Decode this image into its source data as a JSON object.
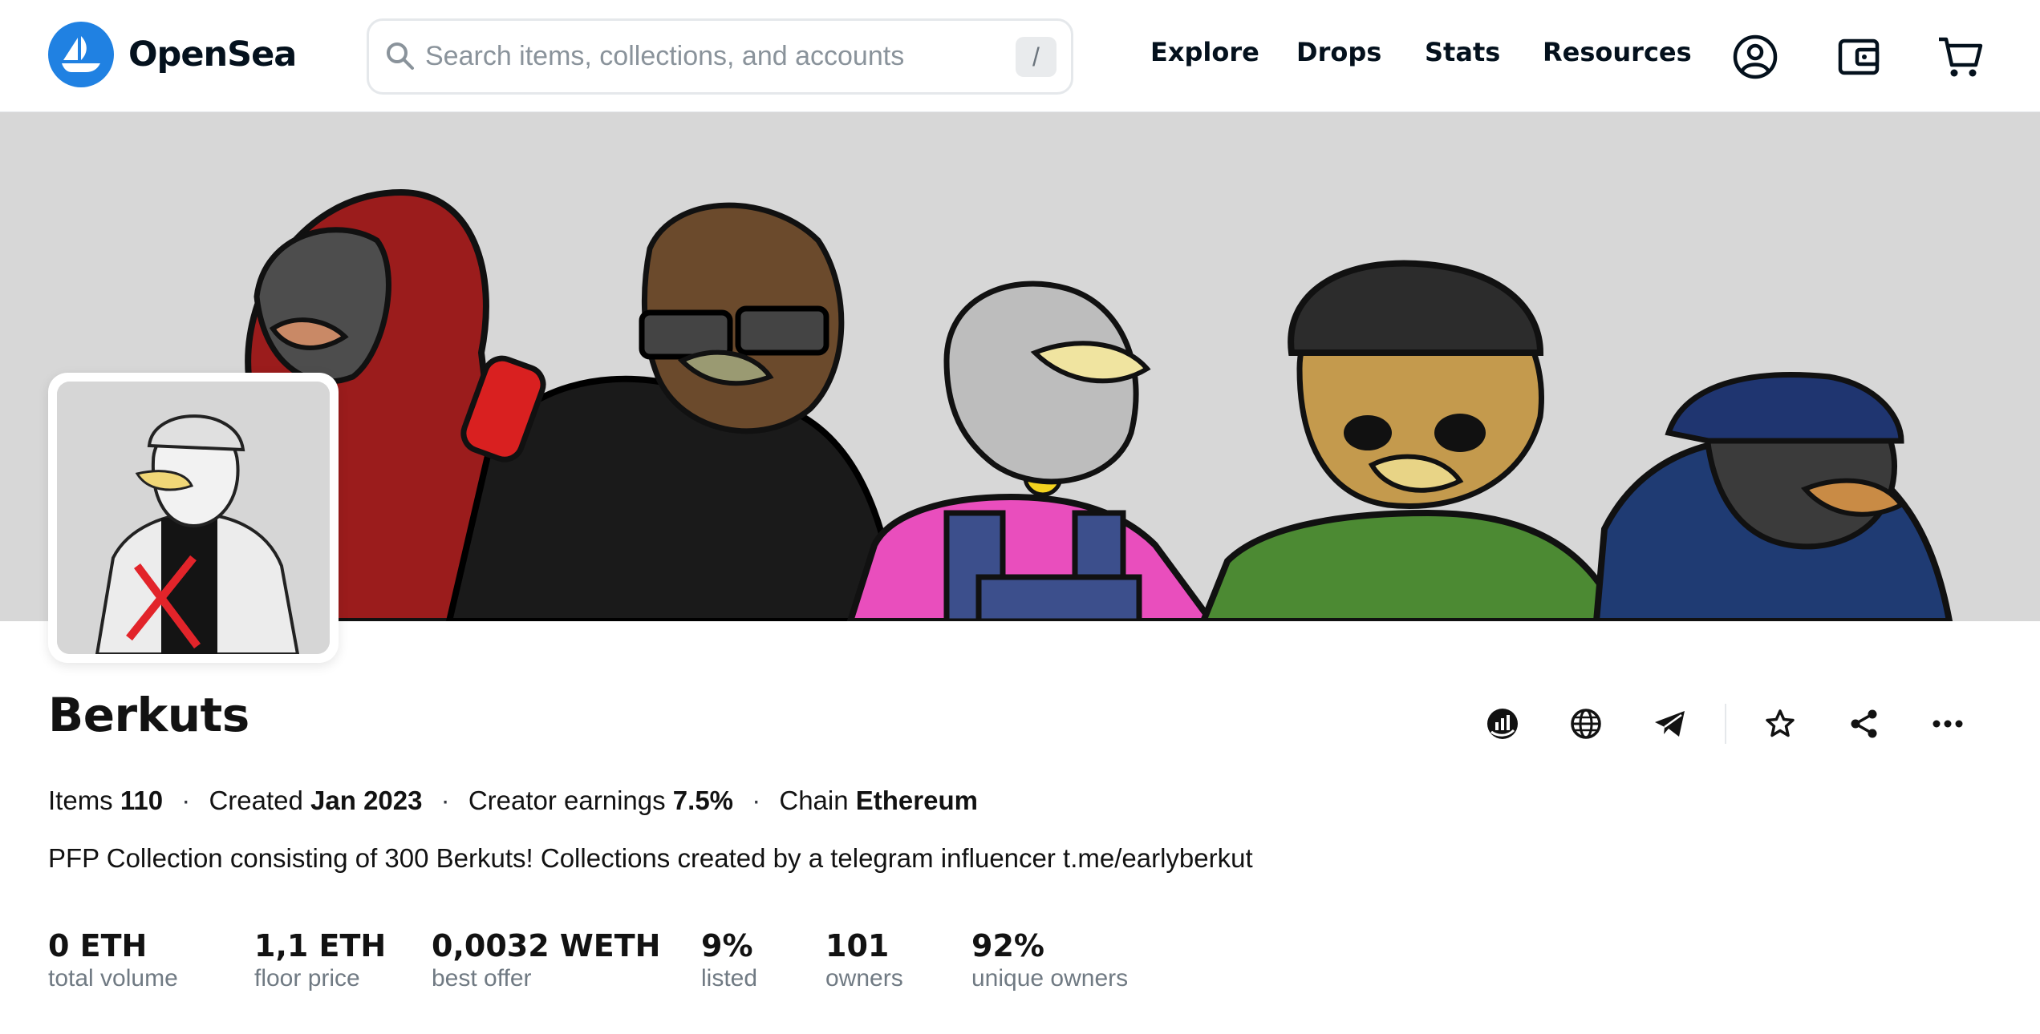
{
  "header": {
    "brand": "OpenSea",
    "search": {
      "placeholder": "Search items, collections, and accounts",
      "shortcut": "/"
    },
    "nav": [
      "Explore",
      "Drops",
      "Stats",
      "Resources"
    ],
    "icons": [
      "profile-icon",
      "wallet-icon",
      "cart-icon"
    ]
  },
  "collection": {
    "name": "Berkuts",
    "meta": {
      "items_label": "Items",
      "items_value": "110",
      "created_label": "Created",
      "created_value": "Jan 2023",
      "earnings_label": "Creator earnings",
      "earnings_value": "7.5%",
      "chain_label": "Chain",
      "chain_value": "Ethereum"
    },
    "description": "PFP Collection consisting of 300 Berkuts! Collections created by a telegram influencer t.me/earlyberkut",
    "actions": [
      "activity-chart-icon",
      "globe-icon",
      "telegram-icon",
      "star-icon",
      "share-icon",
      "more-icon"
    ],
    "stats": [
      {
        "value": "0 ETH",
        "label": "total volume"
      },
      {
        "value": "1,1 ETH",
        "label": "floor price"
      },
      {
        "value": "0,0032 WETH",
        "label": "best offer"
      },
      {
        "value": "9%",
        "label": "listed"
      },
      {
        "value": "101",
        "label": "owners"
      },
      {
        "value": "92%",
        "label": "unique owners"
      }
    ]
  },
  "colors": {
    "brand": "#2081e2",
    "text": "#121212",
    "muted": "#707a83",
    "banner_bg": "#d7d7d7"
  }
}
